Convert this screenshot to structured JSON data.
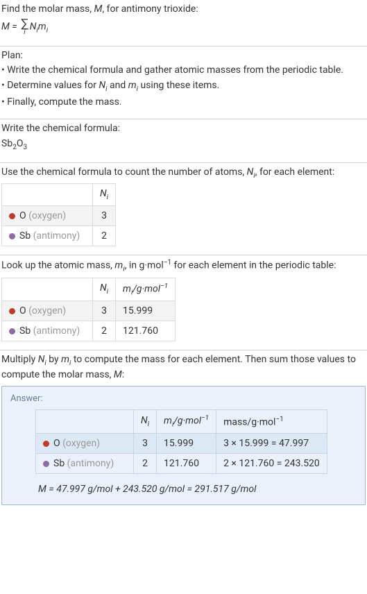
{
  "intro": {
    "line1_a": "Find the molar mass, ",
    "line1_b": "M",
    "line1_c": ", for antimony trioxide:",
    "formula_lhs": "M = ",
    "formula_rhs": "N",
    "formula_rhs2": "m",
    "sum_idx": "i",
    "sub_i": "i"
  },
  "plan": {
    "heading": "Plan:",
    "b1": "• Write the chemical formula and gather atomic masses from the periodic table.",
    "b2_a": "• Determine values for ",
    "b2_b": " and ",
    "b2_c": " using these items.",
    "Ni": "N",
    "mi": "m",
    "sub_i": "i",
    "b3": "• Finally, compute the mass."
  },
  "formula_section": {
    "heading": "Write the chemical formula:",
    "sb": "Sb",
    "n2": "2",
    "o": "O",
    "n3": "3"
  },
  "count_section": {
    "heading_a": "Use the chemical formula to count the number of atoms, ",
    "heading_b": ", for each element:",
    "Ni": "N",
    "sub_i": "i",
    "col_Ni": "N",
    "row_o_label": "O ",
    "row_o_name": "(oxygen)",
    "row_o_val": "3",
    "row_sb_label": "Sb ",
    "row_sb_name": "(antimony)",
    "row_sb_val": "2"
  },
  "mass_section": {
    "heading_a": "Look up the atomic mass, ",
    "heading_b": ", in g·mol",
    "heading_c": " for each element in the periodic table:",
    "mi": "m",
    "sub_i": "i",
    "sup_neg1": "−1",
    "col_Ni": "N",
    "col_mi_a": "m",
    "col_mi_b": "/g·mol",
    "row_o_label": "O ",
    "row_o_name": "(oxygen)",
    "row_o_n": "3",
    "row_o_m": "15.999",
    "row_sb_label": "Sb ",
    "row_sb_name": "(antimony)",
    "row_sb_n": "2",
    "row_sb_m": "121.760"
  },
  "mult_section": {
    "heading_a": "Multiply ",
    "heading_b": " by ",
    "heading_c": " to compute the mass for each element. Then sum those values to compute the molar mass, ",
    "heading_d": ":",
    "Ni": "N",
    "mi": "m",
    "M": "M",
    "sub_i": "i"
  },
  "answer": {
    "label": "Answer:",
    "col_Ni": "N",
    "col_mi_a": "m",
    "col_mi_b": "/g·mol",
    "col_mass": "mass/g·mol",
    "sup_neg1": "−1",
    "sub_i": "i",
    "row_o_label": "O ",
    "row_o_name": "(oxygen)",
    "row_o_n": "3",
    "row_o_m": "15.999",
    "row_o_mass": "3 × 15.999 = 47.997",
    "row_sb_label": "Sb ",
    "row_sb_name": "(antimony)",
    "row_sb_n": "2",
    "row_sb_m": "121.760",
    "row_sb_mass": "2 × 121.760 = 243.520",
    "final_a": "M",
    "final_b": " = 47.997 g/mol + 243.520 g/mol = 291.517 g/mol"
  }
}
